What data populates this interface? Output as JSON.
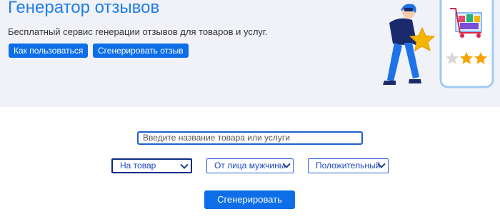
{
  "hero": {
    "title": "Генератор отзывов",
    "subtitle": "Бесплатный сервис генерации отзывов для товаров и услуг.",
    "buttons": {
      "how_to": "Как пользоваться",
      "generate_review": "Сгенерировать отзыв"
    },
    "illustration": {
      "icons": [
        "person-icon",
        "star-icon",
        "phone-icon",
        "shopping-cart-icon",
        "rating-stars-icon"
      ],
      "rating_stars": 3,
      "rating_filled": 2
    }
  },
  "form": {
    "search_placeholder": "Введите название товара или услуги",
    "type_select": {
      "selected": "На товар"
    },
    "voice_select": {
      "selected": "От лица мужчины"
    },
    "tone_select": {
      "selected": "Положительный"
    },
    "submit_label": "Сгенерировать"
  },
  "colors": {
    "accent": "#0d6ee8",
    "title": "#1f7fe6",
    "hero_bg": "#f1f2f8",
    "star": "#f4b400"
  }
}
